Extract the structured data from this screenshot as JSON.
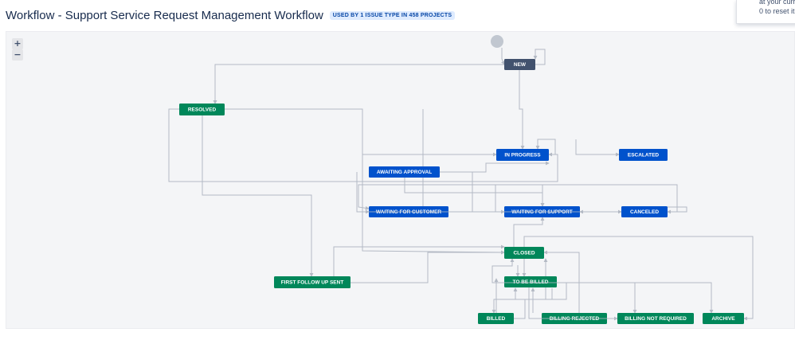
{
  "header": {
    "title": "Workflow - Support Service Request Management Workflow",
    "badge": "USED BY 1 ISSUE TYPE IN 458 PROJECTS"
  },
  "tooltip": {
    "line1": "at your curre",
    "line2": "0 to reset it."
  },
  "zoom": {
    "in_label": "+",
    "out_label": "−"
  },
  "colors": {
    "start": "#c1c7d0",
    "new": "#42526e",
    "in_progress": "#0052cc",
    "done": "#00875a",
    "edge": "#b3b9c4"
  },
  "statuses": [
    {
      "id": "new",
      "label": "NEW",
      "category": "new"
    },
    {
      "id": "resolved",
      "label": "RESOLVED",
      "category": "done"
    },
    {
      "id": "in-progress",
      "label": "IN PROGRESS",
      "category": "in_progress"
    },
    {
      "id": "escalated",
      "label": "ESCALATED",
      "category": "in_progress"
    },
    {
      "id": "awaiting-approval",
      "label": "AWAITING APPROVAL",
      "category": "in_progress"
    },
    {
      "id": "waiting-for-customer",
      "label": "WAITING FOR CUSTOMER",
      "category": "in_progress"
    },
    {
      "id": "waiting-for-support",
      "label": "WAITING FOR SUPPORT",
      "category": "in_progress"
    },
    {
      "id": "canceled",
      "label": "CANCELED",
      "category": "in_progress"
    },
    {
      "id": "closed",
      "label": "CLOSED",
      "category": "done"
    },
    {
      "id": "first-follow-up-sent",
      "label": "FIRST FOLLOW UP SENT",
      "category": "done"
    },
    {
      "id": "to-be-billed",
      "label": "TO BE BILLED",
      "category": "done"
    },
    {
      "id": "billed",
      "label": "BILLED",
      "category": "done"
    },
    {
      "id": "billing-rejected",
      "label": "BILLING REJECTED",
      "category": "done"
    },
    {
      "id": "billing-not-required",
      "label": "BILLING NOT REQUIRED",
      "category": "done"
    },
    {
      "id": "archive",
      "label": "ARCHIVE",
      "category": "done"
    }
  ]
}
